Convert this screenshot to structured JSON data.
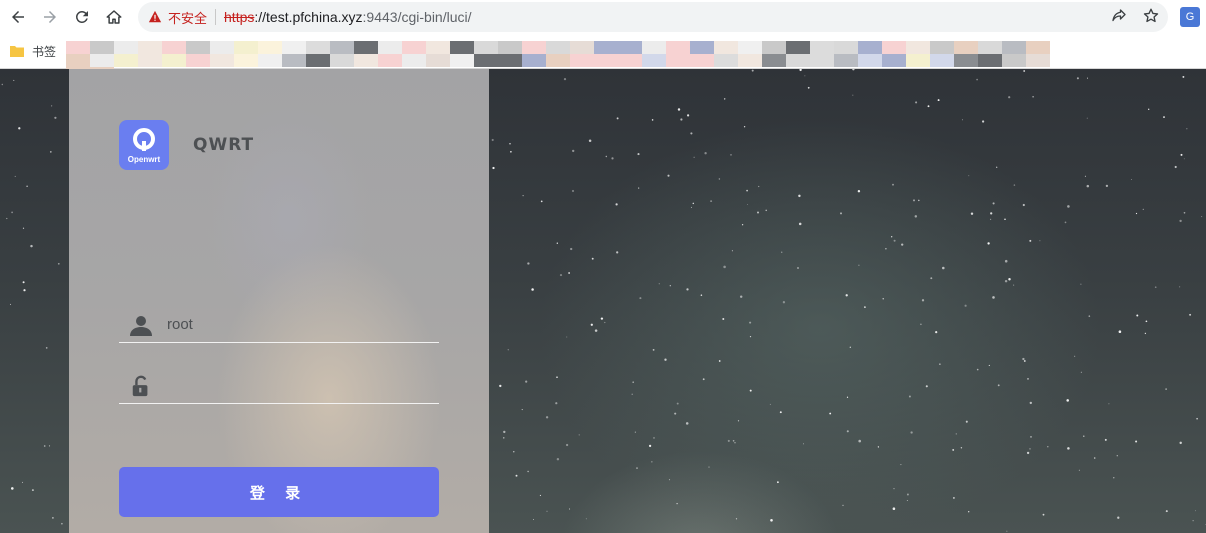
{
  "browser": {
    "security_warning": "不安全",
    "url_scheme": "https",
    "url_host": "://test.pfchina.xyz",
    "url_path": ":9443/cgi-bin/luci/",
    "translate_ext_label": "G"
  },
  "bookmarks_bar": {
    "folder_label": "书签"
  },
  "login": {
    "brand": "QWRT",
    "logo_text": "Openwrt",
    "username_value": "root",
    "password_value": "",
    "submit_label": "登 录"
  },
  "colors": {
    "accent": "#6670eb",
    "logo_bg": "#6a7ef0",
    "warning": "#c5221f"
  }
}
